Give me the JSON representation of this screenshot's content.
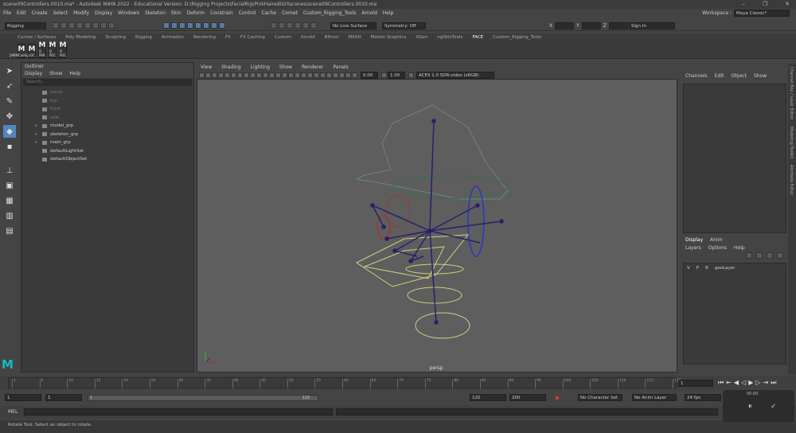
{
  "titlebar": {
    "text": "scene09Controllers.0010.ma* - Autodesk MAYA 2022 - Educational Version: D:\\Rigging Projects\\FacialRig\\PinkHairedGirl\\scenes\\scene09Controllers.0010.ma"
  },
  "menubar": [
    "File",
    "Edit",
    "Create",
    "Select",
    "Modify",
    "Display",
    "Windows",
    "Skeleton",
    "Skin",
    "Deform",
    "Constrain",
    "Control",
    "Cache",
    "Comet",
    "Custom_Rigging_Tools",
    "Arnold",
    "Help"
  ],
  "workspace": {
    "label": "Workspace :",
    "value": "Maya Classic*"
  },
  "status": {
    "menuset": "Rigging",
    "live_surface": "No Live Surface",
    "symmetry": "Symmetry: Off",
    "sign_in": "Sign In",
    "x_label": "X",
    "y_label": "Y",
    "z_label": "Z"
  },
  "shelf_tabs": [
    "Curves / Surfaces",
    "Poly Modeling",
    "Sculpting",
    "Rigging",
    "Animation",
    "Rendering",
    "FX",
    "FX Caching",
    "Custom",
    "Arnold",
    "Bifrost",
    "MASH",
    "Motion Graphics",
    "XGen",
    "ngSkinTools",
    "FACE",
    "Custom_Rigging_Tools"
  ],
  "shelf_active": "FACE",
  "shelf_buttons": [
    {
      "glyph": "M",
      "label": "JAMMCadSymF"
    },
    {
      "glyph": "M",
      "label": "LOC"
    },
    {
      "glyph": "M",
      "label": "D PAR"
    },
    {
      "glyph": "M",
      "label": "D POC"
    },
    {
      "glyph": "M",
      "label": "D POC"
    }
  ],
  "outliner": {
    "title": "Outliner",
    "menus": [
      "Display",
      "Show",
      "Help"
    ],
    "search_placeholder": "Search...",
    "items": [
      {
        "label": "persp",
        "dim": true
      },
      {
        "label": "top",
        "dim": true
      },
      {
        "label": "front",
        "dim": true
      },
      {
        "label": "side",
        "dim": true
      },
      {
        "label": "model_grp",
        "dim": false,
        "exp": "+"
      },
      {
        "label": "skeleton_grp",
        "dim": false,
        "exp": "+"
      },
      {
        "label": "main_grp",
        "dim": false,
        "exp": "+"
      },
      {
        "label": "defaultLightSet",
        "dim": false
      },
      {
        "label": "defaultObjectSet",
        "dim": false
      }
    ]
  },
  "viewport": {
    "menus": [
      "View",
      "Shading",
      "Lighting",
      "Show",
      "Renderer",
      "Panels"
    ],
    "exposure": "0.00",
    "gamma": "1.00",
    "colorspace": "ACES 1.0 SDR-video (sRGB)",
    "camera_label": "persp"
  },
  "channels": {
    "menus": [
      "Channels",
      "Edit",
      "Object",
      "Show"
    ]
  },
  "layers": {
    "tabs": [
      "Display",
      "Anim"
    ],
    "menus": [
      "Layers",
      "Options",
      "Help"
    ],
    "row": {
      "v": "V",
      "p": "P",
      "r": "R",
      "name": "geoLayer"
    }
  },
  "side_tabs": [
    "Channel Box / Layer Editor",
    "Modeling Toolkit",
    "Attribute Editor"
  ],
  "timeline": {
    "ticks": [
      "1",
      "5",
      "10",
      "15",
      "20",
      "25",
      "30",
      "35",
      "40",
      "45",
      "50",
      "55",
      "60",
      "65",
      "70",
      "75",
      "80",
      "85",
      "90",
      "95",
      "100",
      "105",
      "110",
      "115",
      "120"
    ],
    "current": "1"
  },
  "range": {
    "start": "1",
    "inner_start": "1",
    "inner_start2": "1",
    "inner_end": "120",
    "end": "120",
    "end2": "200",
    "character_set": "No Character Set",
    "anim_layer": "No Anim Layer",
    "fps": "24 fps"
  },
  "cmd": {
    "label": "MEL"
  },
  "help": {
    "text": "Rotate Tool: Select an object to rotate."
  },
  "rec": {
    "time": "00:00"
  }
}
